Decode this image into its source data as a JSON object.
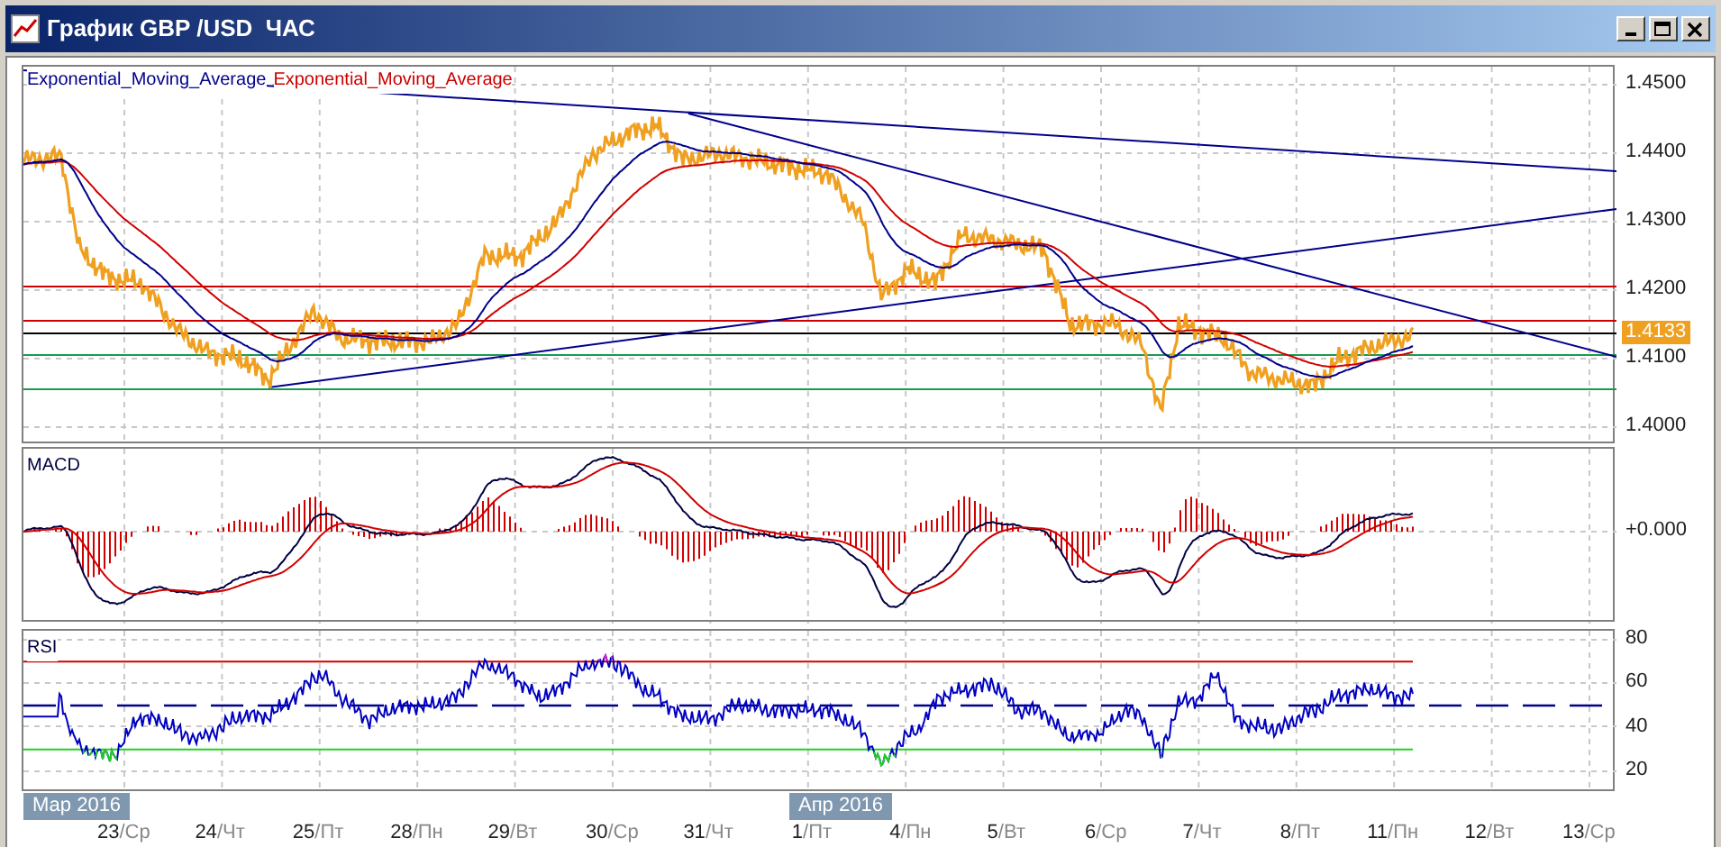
{
  "window": {
    "title": "График GBP /USD  ЧАС"
  },
  "price_panel": {
    "legend": [
      {
        "text": "Exponential_Moving_Average",
        "color": "#00008b"
      },
      {
        "text": "Exponential_Moving_Average",
        "color": "#cc0000"
      }
    ],
    "axis_labels": [
      "1.4500",
      "1.4400",
      "1.4300",
      "1.4200",
      "1.4100",
      "1.4000"
    ],
    "current_price": "1.4133"
  },
  "macd_panel": {
    "label": "MACD",
    "axis_labels": [
      "+0.000"
    ]
  },
  "rsi_panel": {
    "label": "RSI",
    "axis_labels": [
      "80",
      "60",
      "40",
      "20"
    ]
  },
  "time_axis": {
    "months": [
      {
        "text": "Мар 2016"
      },
      {
        "text": "Апр 2016"
      }
    ],
    "dates": [
      {
        "day": "23",
        "weekday": "/Ср"
      },
      {
        "day": "24",
        "weekday": "/Чт"
      },
      {
        "day": "25",
        "weekday": "/Пт"
      },
      {
        "day": "28",
        "weekday": "/Пн"
      },
      {
        "day": "29",
        "weekday": "/Вт"
      },
      {
        "day": "30",
        "weekday": "/Ср"
      },
      {
        "day": "31",
        "weekday": "/Чт"
      },
      {
        "day": "1",
        "weekday": "/Пт"
      },
      {
        "day": "4",
        "weekday": "/Пн"
      },
      {
        "day": "5",
        "weekday": "/Вт"
      },
      {
        "day": "6",
        "weekday": "/Ср"
      },
      {
        "day": "7",
        "weekday": "/Чт"
      },
      {
        "day": "8",
        "weekday": "/Пт"
      },
      {
        "day": "11",
        "weekday": "/Пн"
      },
      {
        "day": "12",
        "weekday": "/Вт"
      },
      {
        "day": "13",
        "weekday": "/Ср"
      }
    ]
  }
}
